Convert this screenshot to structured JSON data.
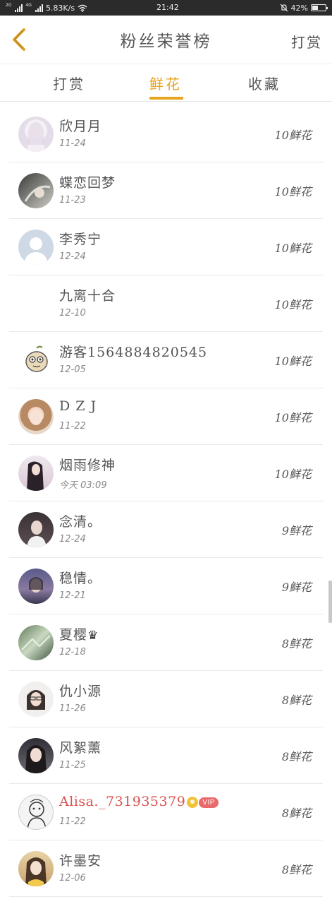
{
  "status_bar": {
    "network_tag_1": "2G",
    "network_tag_2": "4G",
    "speed": "5.83K/s",
    "time": "21:42",
    "battery_percent": "42%",
    "battery_level": 0.42
  },
  "header": {
    "title": "粉丝荣誉榜",
    "action_label": "打赏",
    "back_icon": "chevron-left-icon",
    "accent_color": "#e6a41f"
  },
  "tabs": [
    {
      "label": "打赏"
    },
    {
      "label": "鲜花",
      "active": true
    },
    {
      "label": "收藏"
    }
  ],
  "rows": [
    {
      "name": "欣月月",
      "date": "11-24",
      "amount": "10鲜花"
    },
    {
      "name": "蝶恋回梦",
      "date": "11-23",
      "amount": "10鲜花"
    },
    {
      "name": "李秀宁",
      "date": "12-24",
      "amount": "10鲜花"
    },
    {
      "name": "九离十合",
      "date": "12-10",
      "amount": "10鲜花"
    },
    {
      "name": "游客1564884820545",
      "date": "12-05",
      "amount": "10鲜花"
    },
    {
      "name": "D Z J",
      "date": "11-22",
      "amount": "10鲜花"
    },
    {
      "name": "烟雨修神",
      "date": "今天 03:09",
      "amount": "10鲜花"
    },
    {
      "name": "念清。",
      "date": "12-24",
      "amount": "9鲜花"
    },
    {
      "name": "稳情。",
      "date": "12-21",
      "amount": "9鲜花"
    },
    {
      "name": "夏樱",
      "name_symbol": "♛",
      "date": "12-18",
      "amount": "8鲜花"
    },
    {
      "name": "仇小源",
      "date": "11-26",
      "amount": "8鲜花"
    },
    {
      "name": "风絮薰",
      "date": "11-25",
      "amount": "8鲜花"
    },
    {
      "name": "Alisa._731935379",
      "vip_label": "VIP",
      "date": "11-22",
      "amount": "8鲜花"
    },
    {
      "name": "许墨安",
      "date": "12-06",
      "amount": "8鲜花"
    }
  ]
}
